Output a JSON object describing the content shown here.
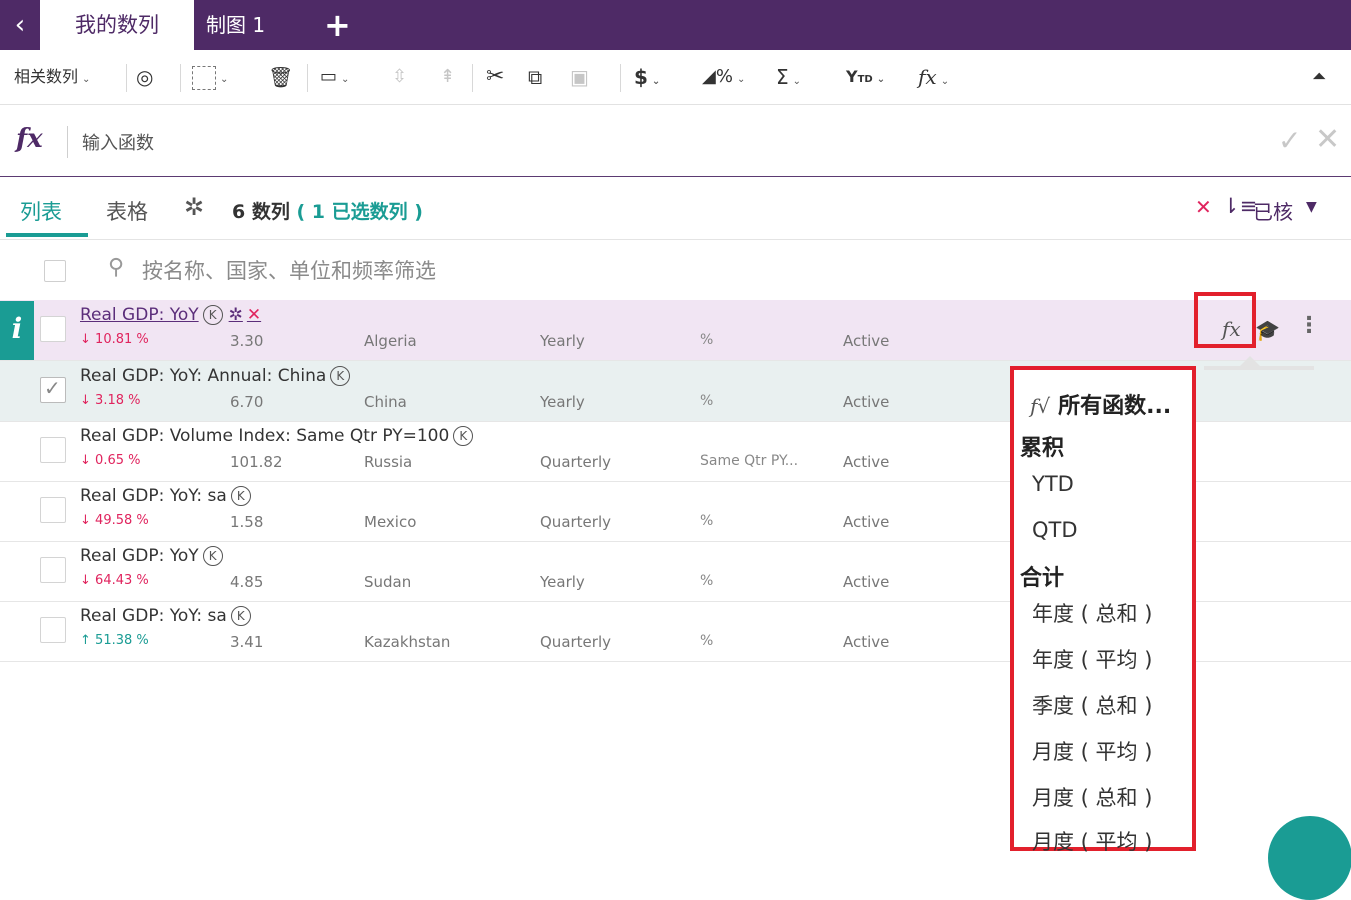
{
  "tabs": {
    "back_icon": "chevron-left-icon",
    "active": "我的数列",
    "chart": "制图 1",
    "add": "+"
  },
  "toolbar": {
    "related": "相关数列",
    "icons": [
      "eye-icon",
      "selection-icon",
      "trash-icon",
      "folder-icon",
      "move-up-icon",
      "move-top-icon",
      "cut-icon",
      "copy-icon",
      "paste-icon",
      "currency-icon",
      "percent-icon",
      "sum-icon",
      "ytd-icon",
      "function-icon",
      "collapse-icon"
    ],
    "currency": "$",
    "sum": "Σ",
    "ytd": "Y",
    "ytd_sub": "TD",
    "fx": "fx"
  },
  "formula": {
    "icon": "fx",
    "placeholder": "输入函数"
  },
  "list_header": {
    "tab_list": "列表",
    "tab_table": "表格",
    "count_text": "6 数列",
    "selected_text": "( 1 已选数列 )",
    "sort_label": "已核"
  },
  "filter": {
    "placeholder": "按名称、国家、单位和频率筛选"
  },
  "rows": [
    {
      "name": "Real GDP: YoY",
      "change": "10.81 %",
      "dir": "down",
      "value": "3.30",
      "country": "Algeria",
      "freq": "Yearly",
      "unit": "%",
      "status": "Active"
    },
    {
      "name": "Real GDP: YoY: Annual: China",
      "change": "3.18 %",
      "dir": "down",
      "value": "6.70",
      "country": "China",
      "freq": "Yearly",
      "unit": "%",
      "status": "Active"
    },
    {
      "name": "Real GDP: Volume Index: Same Qtr PY=100",
      "change": "0.65 %",
      "dir": "down",
      "value": "101.82",
      "country": "Russia",
      "freq": "Quarterly",
      "unit": "Same Qtr PY...",
      "status": "Active"
    },
    {
      "name": "Real GDP: YoY: sa",
      "change": "49.58 %",
      "dir": "down",
      "value": "1.58",
      "country": "Mexico",
      "freq": "Quarterly",
      "unit": "%",
      "status": "Active"
    },
    {
      "name": "Real GDP: YoY",
      "change": "64.43 %",
      "dir": "down",
      "value": "4.85",
      "country": "Sudan",
      "freq": "Yearly",
      "unit": "%",
      "status": "Active"
    },
    {
      "name": "Real GDP: YoY: sa",
      "change": "51.38 %",
      "dir": "up",
      "value": "3.41",
      "country": "Kazakhstan",
      "freq": "Quarterly",
      "unit": "%",
      "status": "Active"
    }
  ],
  "row_actions": {
    "fx": "fx",
    "info": "i",
    "k": "K"
  },
  "dropdown": {
    "all_icon": "f√",
    "all": "所有函数...",
    "group1": "累积",
    "group1_items": [
      "YTD",
      "QTD"
    ],
    "group2": "合计",
    "group2_items": [
      "年度 ( 总和 )",
      "年度 ( 平均 )",
      "季度 ( 总和 )",
      "月度 ( 平均 )",
      "月度 ( 总和 )",
      "月度 ( 平均 )"
    ]
  },
  "colors": {
    "brand": "#4e2a66",
    "accent": "#1a9c94",
    "negative": "#e0245e",
    "highlight": "#e2202c"
  }
}
